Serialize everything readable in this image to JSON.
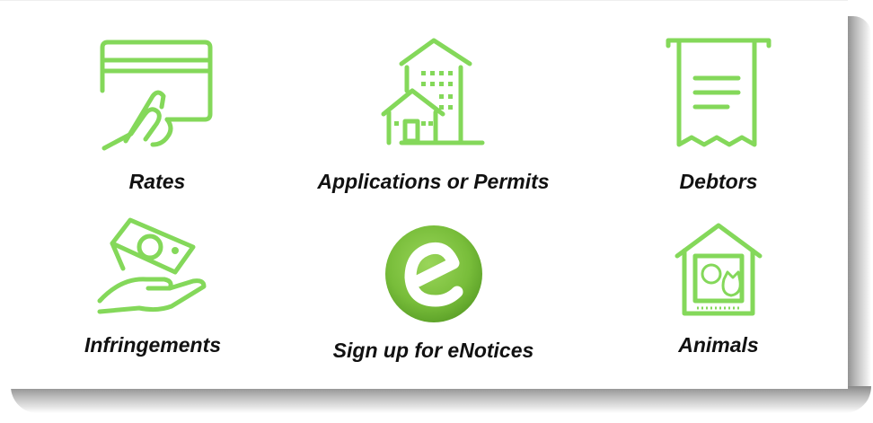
{
  "accent_color": "#84d85a",
  "tiles": [
    {
      "label": "Rates",
      "icon": "credit-card-hand-icon"
    },
    {
      "label": "Applications or Permits",
      "icon": "buildings-icon"
    },
    {
      "label": "Debtors",
      "icon": "receipt-icon"
    },
    {
      "label": "Infringements",
      "icon": "money-hand-icon"
    },
    {
      "label": "Sign up for eNotices",
      "icon": "enotices-logo-icon"
    },
    {
      "label": "Animals",
      "icon": "animal-house-icon"
    }
  ]
}
